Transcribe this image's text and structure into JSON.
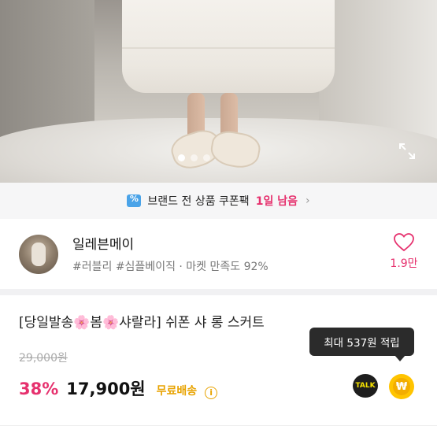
{
  "hero": {
    "image_alt": "",
    "slides": 3,
    "active_slide": 1,
    "expand_icon": "expand-icon"
  },
  "coupon": {
    "icon": "coupon-icon",
    "text": "브랜드 전 상품 쿠폰팩",
    "remaining": "1일 남음",
    "chevron": "›"
  },
  "seller": {
    "name": "일레븐메이",
    "tags": "#러블리 #심플베이직 · 마켓 만족도 92%",
    "like_count": "1.9만",
    "like_color": "#e6316e"
  },
  "product": {
    "title": "[당일발송🌸봄🌸샤랄라] 쉬폰 샤 롱 스커트",
    "original_price": "29,000원",
    "discount": "38%",
    "price": "17,900원",
    "shipping": "무료배송",
    "info_icon": "i"
  },
  "tooltip": {
    "text": "최대 537원 적립"
  },
  "actions": {
    "talk_label": "TALK",
    "point_symbol": "₩"
  },
  "colors": {
    "accent": "#e6316e",
    "shipping": "#e8a300",
    "point": "#ffc400"
  }
}
